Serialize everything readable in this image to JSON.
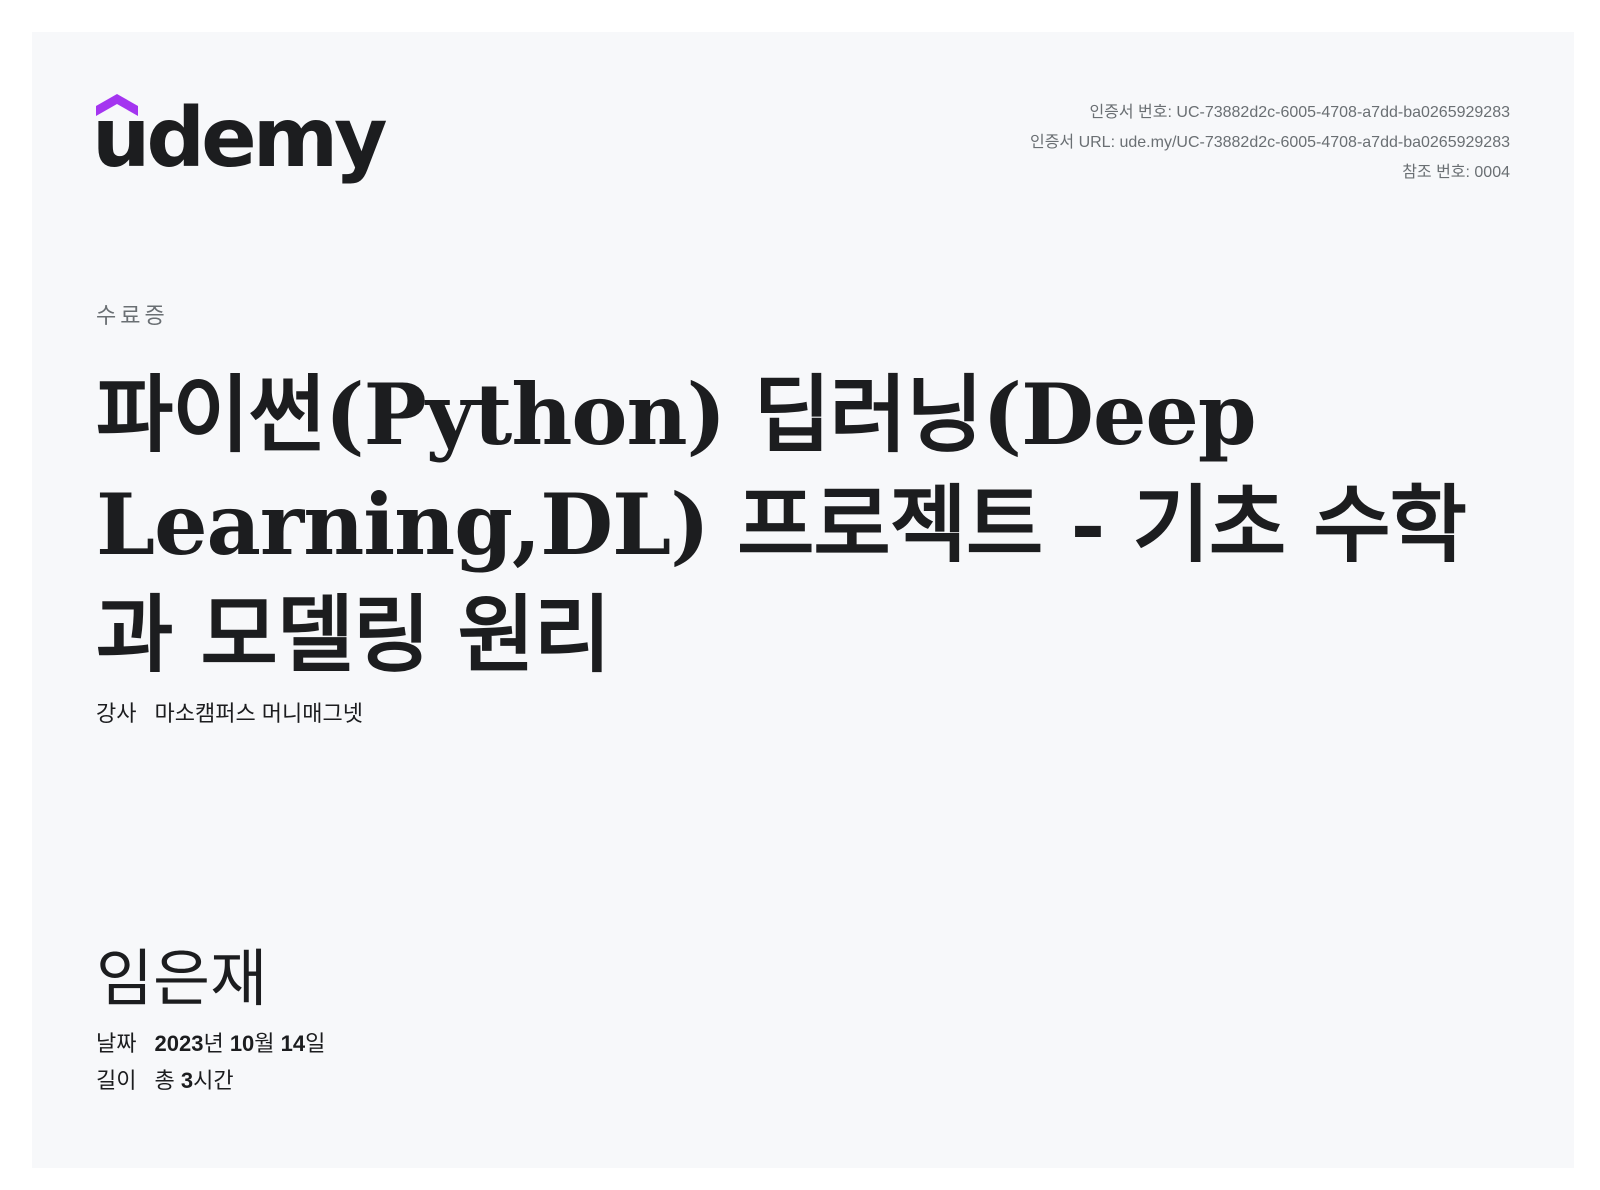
{
  "logo": {
    "text": "udemy",
    "brand_color": "#a435f0"
  },
  "meta": {
    "cert_number": "인증서 번호: UC-73882d2c-6005-4708-a7dd-ba0265929283",
    "cert_url": "인증서 URL: ude.my/UC-73882d2c-6005-4708-a7dd-ba0265929283",
    "reference": "참조 번호: 0004"
  },
  "certificate_label": "수료증",
  "course_title": "파이썬(Python) 딥러닝(Deep Learning,DL) 프로젝트 - 기초 수학과 모델링 원리",
  "instructor": {
    "label": "강사",
    "name": "마소캠퍼스 머니매그넷"
  },
  "recipient": "임은재",
  "date": {
    "label": "날짜",
    "year": "2023",
    "year_unit": "년",
    "month": "10",
    "month_unit": "월",
    "day": "14",
    "day_unit": "일"
  },
  "length": {
    "label": "길이",
    "prefix": "총",
    "hours": "3",
    "unit": "시간"
  }
}
